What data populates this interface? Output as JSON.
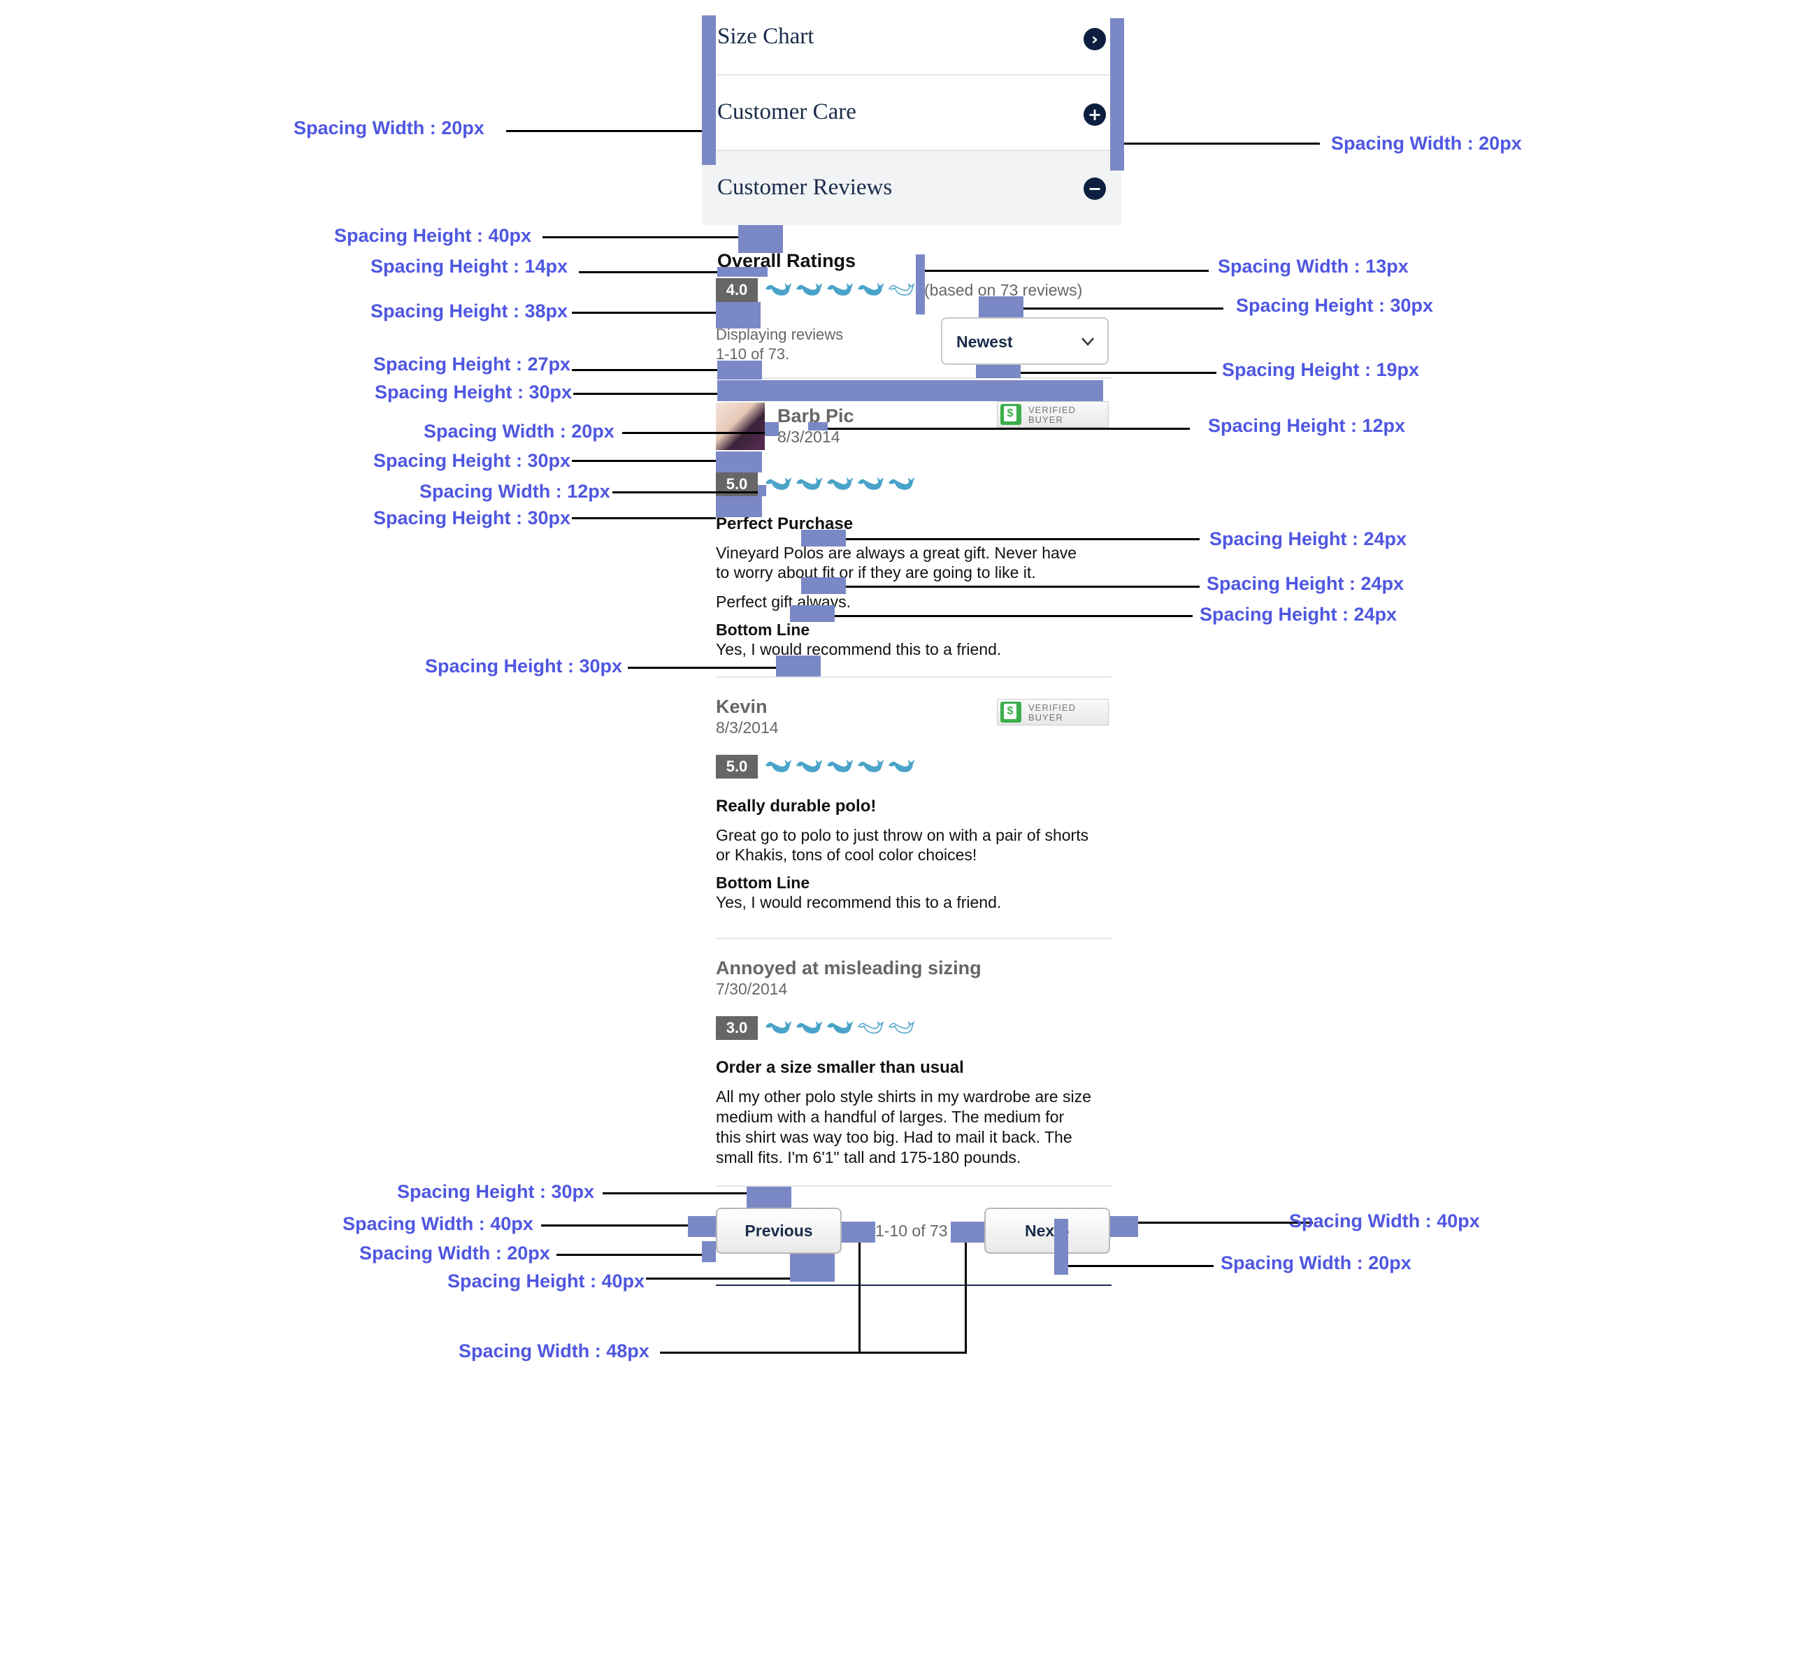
{
  "accordion": {
    "size_chart": "Size Chart",
    "customer_care": "Customer Care",
    "customer_reviews": "Customer Reviews"
  },
  "overall": {
    "heading": "Overall Ratings",
    "score": "4.0",
    "rating": 4,
    "based_on": "(based on 73 reviews)",
    "displaying_line1": "Displaying reviews",
    "displaying_line2": "1-10 of 73.",
    "sort_selected": "Newest"
  },
  "verified": {
    "line1": "VERIFIED",
    "line2": "BUYER"
  },
  "reviews": [
    {
      "name": "Barb Pic",
      "date": "8/3/2014",
      "score": "5.0",
      "rating": 5,
      "title": "Perfect Purchase",
      "body1": "Vineyard Polos are always a great gift. Never have",
      "body2": "to worry about fit or if they are going to like it.",
      "body3": "Perfect gift always.",
      "bottom_line_label": "Bottom Line",
      "bottom_line": "Yes, I would recommend this to a friend."
    },
    {
      "name": "Kevin",
      "date": "8/3/2014",
      "score": "5.0",
      "rating": 5,
      "title": "Really durable polo!",
      "body1": "Great go to polo to just throw on with a pair of shorts",
      "body2": "or Khakis, tons of cool color choices!",
      "bottom_line_label": "Bottom Line",
      "bottom_line": "Yes, I would recommend this to a friend."
    },
    {
      "name": "Annoyed at misleading sizing",
      "date": "7/30/2014",
      "score": "3.0",
      "rating": 3,
      "title": "Order a size smaller than usual",
      "body1": "All my other polo style shirts in my wardrobe are size",
      "body2": "medium with a handful of larges. The medium for",
      "body3": "this shirt was way too big. Had to mail it back. The",
      "body4": "small fits. I'm 6'1\" tall and 175-180 pounds."
    }
  ],
  "pagination": {
    "previous": "Previous",
    "range": "1-10 of 73",
    "next": "Next"
  },
  "annotations": {
    "a1": "Spacing Width : 20px",
    "a2": "Spacing Width : 20px",
    "a3": "Spacing Height : 40px",
    "a4": "Spacing Height : 14px",
    "a5": "Spacing Width : 13px",
    "a6": "Spacing Height : 38px",
    "a7": "Spacing Height : 30px",
    "a8": "Spacing Height : 27px",
    "a9": "Spacing Height : 19px",
    "a10": "Spacing Height : 30px",
    "a11": "Spacing Width : 20px",
    "a12": "Spacing Height : 12px",
    "a13": "Spacing Height : 30px",
    "a14": "Spacing Width : 12px",
    "a15": "Spacing Height : 30px",
    "a16": "Spacing Height : 24px",
    "a17": "Spacing Height : 24px",
    "a18": "Spacing Height : 24px",
    "a19": "Spacing Height : 30px",
    "a20": "Spacing Height : 30px",
    "a21": "Spacing Width : 40px",
    "a22": "Spacing Width : 40px",
    "a23": "Spacing Width : 20px",
    "a24": "Spacing Width : 20px",
    "a25": "Spacing Height : 40px",
    "a26": "Spacing Width : 48px"
  },
  "colors": {
    "navy": "#0c1f3f",
    "annotation_text": "#4f57e0",
    "spacing_marker": "#7b88c6",
    "whale_fill": "#4aa3c8",
    "badge": "#666666",
    "verified_green": "#3cae4a"
  }
}
